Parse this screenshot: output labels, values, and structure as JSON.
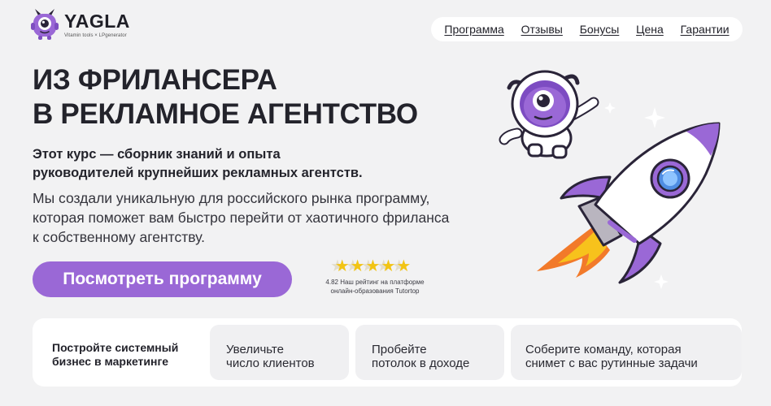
{
  "brand": {
    "name": "YAGLA",
    "tagline": "Vitamin tools × LPgenerator",
    "colors": {
      "accent": "#9a68d6",
      "dark": "#23232b",
      "star": "#f2c414",
      "flame": "#f27a2a"
    }
  },
  "nav": {
    "items": [
      {
        "label": "Программа"
      },
      {
        "label": "Отзывы"
      },
      {
        "label": "Бонусы"
      },
      {
        "label": "Цена"
      },
      {
        "label": "Гарантии"
      }
    ]
  },
  "hero": {
    "title_lines": [
      "ИЗ ФРИЛАНСЕРА",
      "В РЕКЛАМНОЕ АГЕНТСТВО"
    ],
    "subtitle_lines": [
      "Этот курс — сборник знаний и опыта",
      "руководителей крупнейших рекламных агентств."
    ],
    "description_lines": [
      "Мы создали уникальную для российского рынка программу,",
      "которая поможет вам быстро перейти от хаотичного фриланса",
      "к собственному агентству."
    ],
    "cta_label": "Посмотреть программу"
  },
  "rating": {
    "stars_filled": 4.82,
    "stars_max": 5,
    "caption_lines": [
      "4.82 Наш рейтинг на платформе",
      "онлайн-образования Tutortop"
    ]
  },
  "illustration": {
    "icons": [
      "mascot-astronaut-icon",
      "rocket-icon",
      "sparkle-icon"
    ]
  },
  "benefits": {
    "lead_lines": [
      "Постройте системный",
      "бизнес в маркетинге"
    ],
    "cards": [
      {
        "lines": [
          "Увеличьте",
          "число клиентов"
        ]
      },
      {
        "lines": [
          "Пробейте",
          "потолок в доходе"
        ]
      },
      {
        "lines": [
          "Соберите команду, которая",
          "снимет с вас рутинные задачи"
        ]
      }
    ]
  }
}
